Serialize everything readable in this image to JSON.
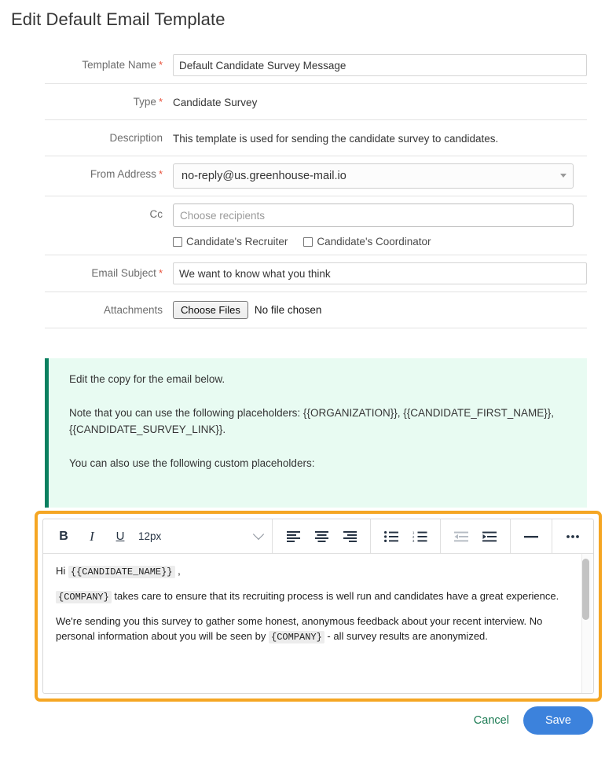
{
  "page": {
    "title": "Edit Default Email Template"
  },
  "form": {
    "rows": [
      {
        "label": "Template Name",
        "required": true,
        "kind": "input",
        "value": "Default Candidate Survey Message"
      },
      {
        "label": "Type",
        "required": true,
        "kind": "static",
        "value": "Candidate Survey"
      },
      {
        "label": "Description",
        "required": false,
        "kind": "static",
        "value": "This template is used for sending the candidate survey to candidates."
      },
      {
        "label": "From Address",
        "required": true,
        "kind": "select",
        "value": "no-reply@us.greenhouse-mail.io"
      },
      {
        "label": "Cc",
        "required": false,
        "kind": "cc",
        "value": "",
        "placeholder": "Choose recipients"
      },
      {
        "label": "Email Subject",
        "required": true,
        "kind": "input",
        "value": "We want to know what you think"
      },
      {
        "label": "Attachments",
        "required": false,
        "kind": "file",
        "button_label": "Choose Files",
        "note": "No file chosen"
      }
    ],
    "required_marker": "*",
    "cc_checkboxes": [
      {
        "label": "Candidate's Recruiter",
        "checked": false
      },
      {
        "label": "Candidate's Coordinator",
        "checked": false
      }
    ]
  },
  "info_panel": {
    "accent_color": "#0a8060",
    "background_color": "#e8fbf2",
    "paragraphs": [
      "Edit the copy for the email below.",
      "Note that you can use the following placeholders: {{ORGANIZATION}}, {{CANDIDATE_FIRST_NAME}}, {{CANDIDATE_SURVEY_LINK}}.",
      "You can also use the following custom placeholders:"
    ]
  },
  "editor": {
    "highlight_color": "#f5a623",
    "toolbar": {
      "bold": "B",
      "italic": "I",
      "underline": "U",
      "font_size": "12px",
      "align_left": "align-left",
      "align_center": "align-center",
      "align_right": "align-right",
      "bullet_list": "bullet-list",
      "numbered_list": "numbered-list",
      "outdent": "outdent",
      "indent": "indent",
      "horizontal_rule": "horizontal-rule",
      "more": "•••"
    },
    "body": {
      "line1_prefix": "Hi ",
      "line1_placeholder": "{{CANDIDATE_NAME}}",
      "line1_suffix": " ,",
      "line2_placeholder": "{COMPANY}",
      "line2_text": " takes care to ensure that its recruiting process is well run and candidates have a great experience.",
      "line3_part1": "We're sending you this survey to gather some honest, anonymous feedback about your recent interview. No personal information about you will be seen by ",
      "line3_placeholder": "{COMPANY}",
      "line3_part2": " - all survey results are anonymized."
    }
  },
  "footer": {
    "cancel_label": "Cancel",
    "save_label": "Save",
    "save_color": "#3c82dc",
    "cancel_color": "#1a7a52"
  }
}
